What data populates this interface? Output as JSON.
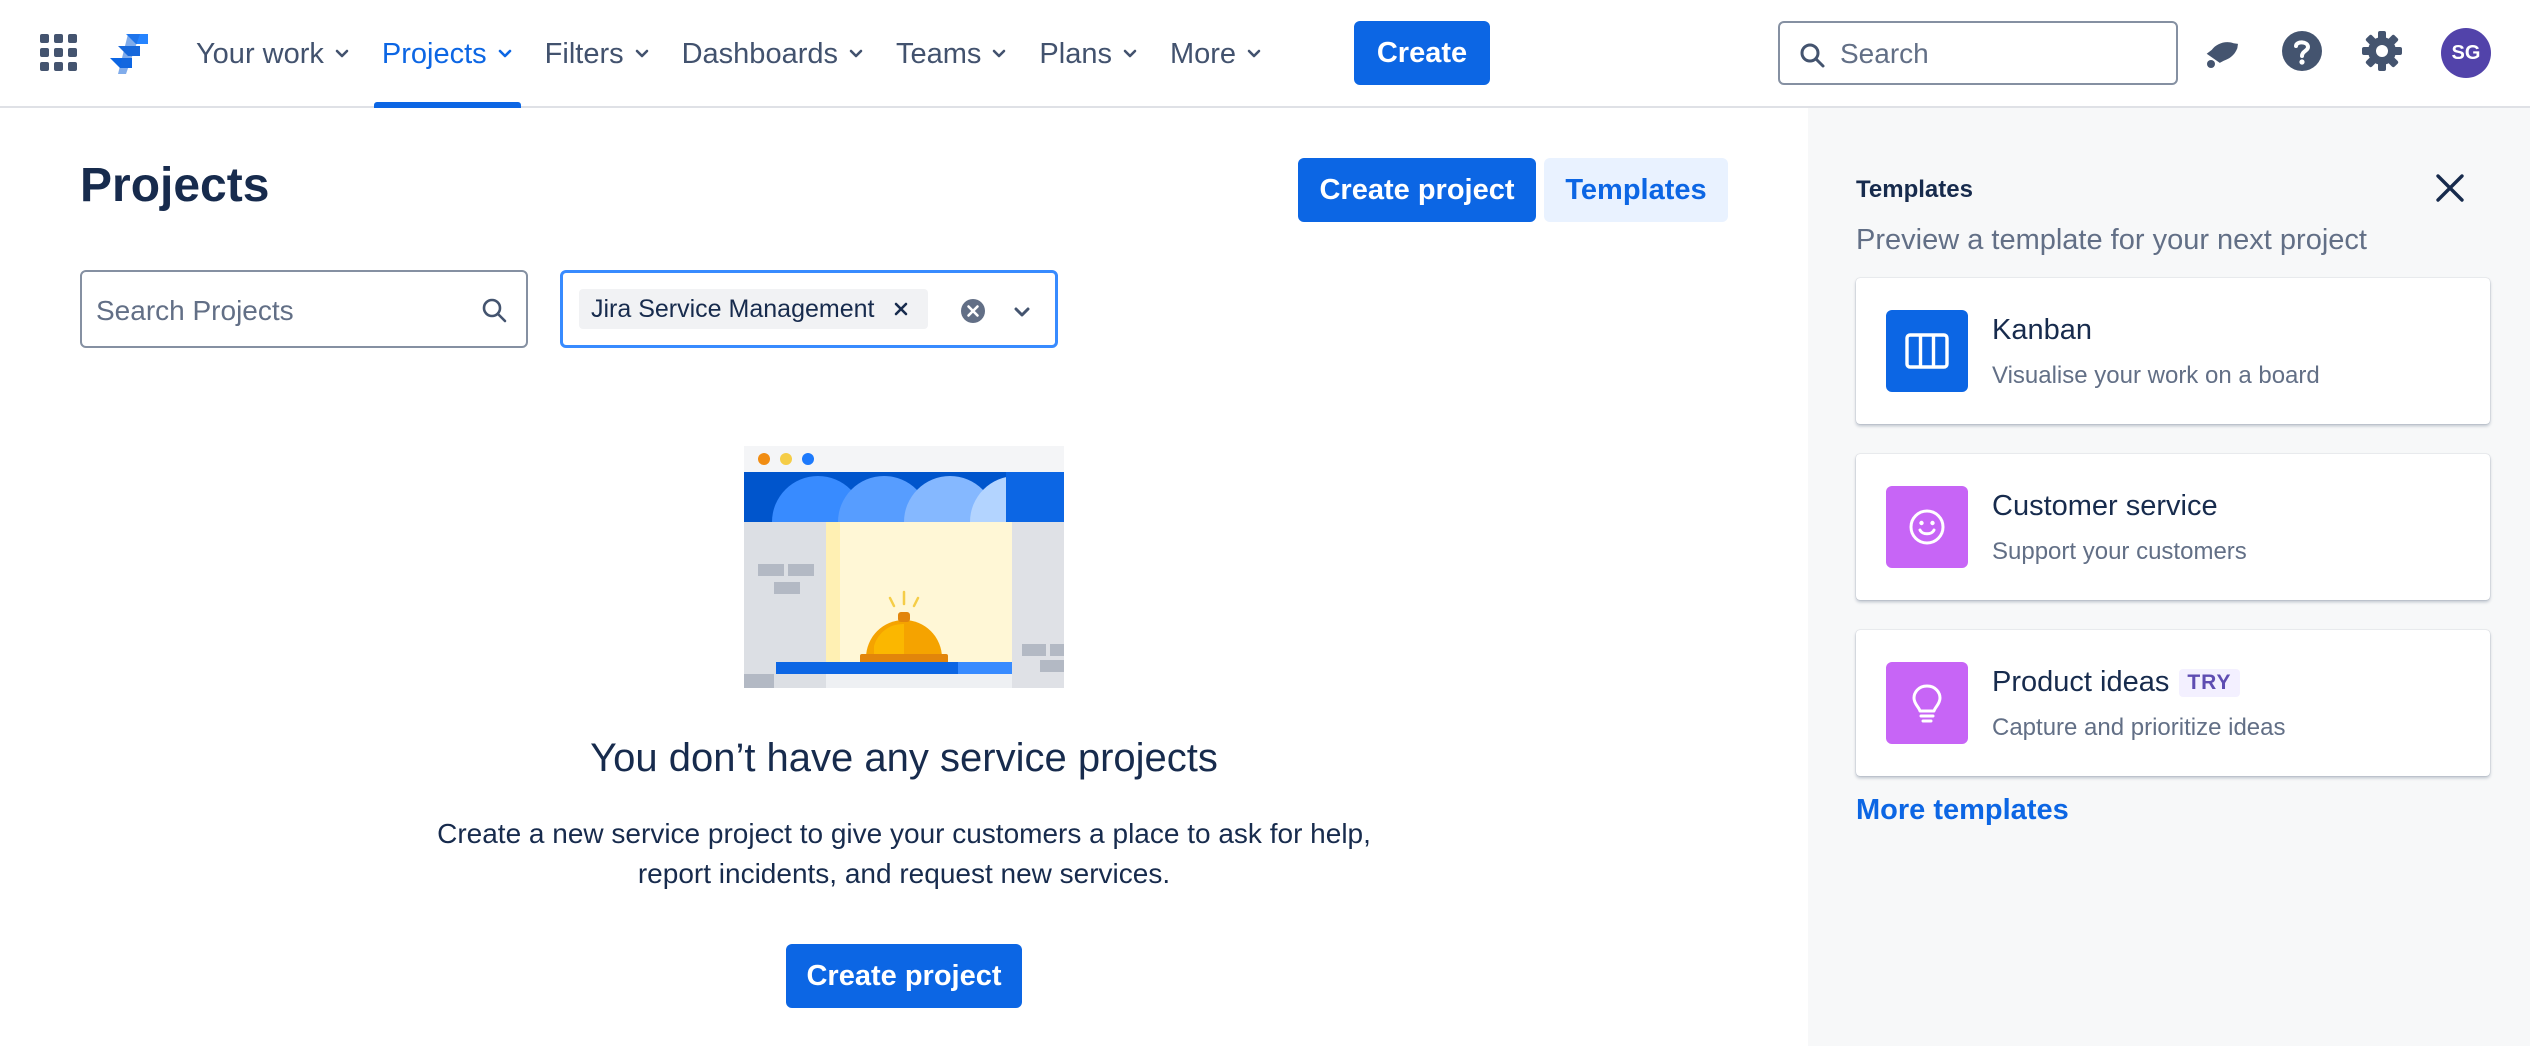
{
  "nav": {
    "items": [
      {
        "label": "Your work",
        "active": false
      },
      {
        "label": "Projects",
        "active": true
      },
      {
        "label": "Filters",
        "active": false
      },
      {
        "label": "Dashboards",
        "active": false
      },
      {
        "label": "Teams",
        "active": false
      },
      {
        "label": "Plans",
        "active": false
      },
      {
        "label": "More",
        "active": false
      }
    ],
    "create_label": "Create",
    "search_placeholder": "Search",
    "avatar_initials": "SG",
    "icons": [
      "app-switcher-icon",
      "jira-logo-icon",
      "notifications-icon",
      "help-icon",
      "settings-icon"
    ]
  },
  "main": {
    "title": "Projects",
    "create_project_label": "Create project",
    "templates_label": "Templates",
    "search_placeholder": "Search Projects",
    "product_filter": {
      "selected": "Jira Service Management"
    },
    "empty_state": {
      "title": "You don’t have any service projects",
      "description": "Create a new service project to give your customers a place to ask for help, report incidents, and request new services.",
      "button_label": "Create project"
    }
  },
  "templates_panel": {
    "title": "Templates",
    "subtitle": "Preview a template for your next project",
    "cards": [
      {
        "name": "Kanban",
        "description": "Visualise your work on a board",
        "icon": "kanban-board-icon",
        "color": "#0c66e4",
        "badge": ""
      },
      {
        "name": "Customer service",
        "description": "Support your customers",
        "icon": "smiley-icon",
        "color": "#c765f6",
        "badge": ""
      },
      {
        "name": "Product ideas",
        "description": "Capture and prioritize ideas",
        "icon": "lightbulb-icon",
        "color": "#c765f6",
        "badge": "TRY"
      }
    ],
    "more_label": "More templates"
  },
  "colors": {
    "brand": "#0c66e4",
    "panel_bg": "#f7f8f9",
    "template_purple": "#c765f6",
    "avatar": "#5243aa"
  }
}
